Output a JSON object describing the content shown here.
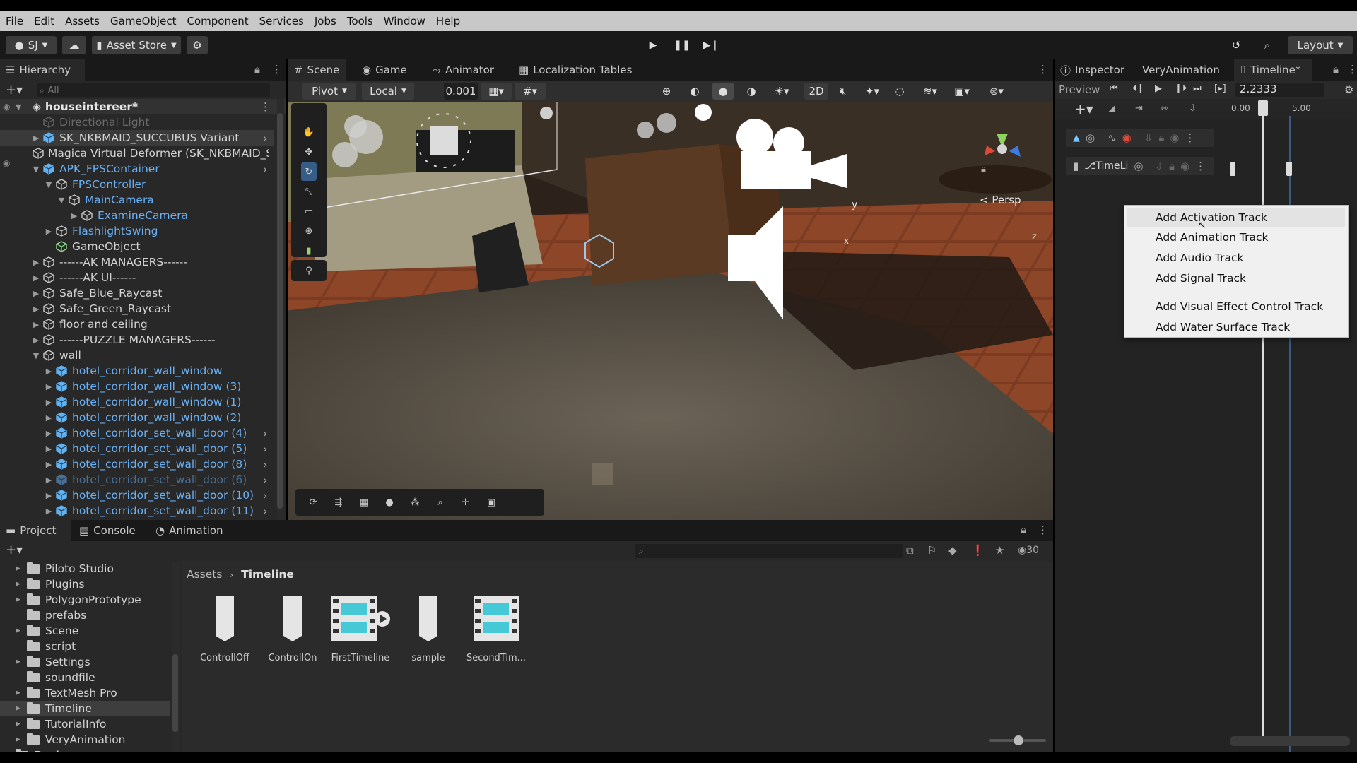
{
  "menu": [
    "File",
    "Edit",
    "Assets",
    "GameObject",
    "Component",
    "Services",
    "Jobs",
    "Tools",
    "Window",
    "Help"
  ],
  "toolbar": {
    "account": "SJ",
    "asset_store": "Asset Store",
    "layout": "Layout"
  },
  "hierarchy": {
    "tab": "Hierarchy",
    "search_placeholder": "All",
    "scene_name": "houseintereer*",
    "items": [
      {
        "label": "Directional Light"
      },
      {
        "label": "SK_NKBMAID_SUCCUBUS Variant"
      },
      {
        "label": "Magica Virtual Deformer (SK_NKBMAID_S"
      },
      {
        "label": "APK_FPSContainer"
      },
      {
        "label": "FPSController"
      },
      {
        "label": "MainCamera"
      },
      {
        "label": "ExamineCamera"
      },
      {
        "label": "FlashlightSwing"
      },
      {
        "label": "GameObject"
      },
      {
        "label": "------AK MANAGERS------"
      },
      {
        "label": "------AK UI------"
      },
      {
        "label": "Safe_Blue_Raycast"
      },
      {
        "label": "Safe_Green_Raycast"
      },
      {
        "label": "floor and ceiling"
      },
      {
        "label": "------PUZZLE MANAGERS------"
      },
      {
        "label": "wall"
      },
      {
        "label": "hotel_corridor_wall_window"
      },
      {
        "label": "hotel_corridor_wall_window (3)"
      },
      {
        "label": "hotel_corridor_wall_window (1)"
      },
      {
        "label": "hotel_corridor_wall_window (2)"
      },
      {
        "label": "hotel_corridor_set_wall_door (4)"
      },
      {
        "label": "hotel_corridor_set_wall_door (5)"
      },
      {
        "label": "hotel_corridor_set_wall_door (8)"
      },
      {
        "label": "hotel_corridor_set_wall_door (6)"
      },
      {
        "label": "hotel_corridor_set_wall_door (10)"
      },
      {
        "label": "hotel_corridor_set_wall_door (11)"
      }
    ]
  },
  "scene": {
    "tabs": [
      "Scene",
      "Game",
      "Animator",
      "Localization Tables"
    ],
    "pivot": "Pivot",
    "local": "Local",
    "snap": "0.001",
    "mode_2d": "2D",
    "persp": "< Persp",
    "gizmo_y": "y",
    "gizmo_x": "x",
    "gizmo_z": "z"
  },
  "right_tabs": [
    "Inspector",
    "VeryAnimation",
    "Timeline*"
  ],
  "timeline": {
    "preview": "Preview",
    "time": "2.2333",
    "ruler_start": "0.00",
    "ruler_mark": "5.00",
    "track_label": "TimeLi"
  },
  "context_menu": [
    "Add Activation Track",
    "Add Animation Track",
    "Add Audio Track",
    "Add Signal Track",
    "Add Visual Effect Control Track",
    "Add Water Surface Track"
  ],
  "bottom": {
    "tabs": [
      "Project",
      "Console",
      "Animation"
    ],
    "hidden_count": "30",
    "breadcrumb_root": "Assets",
    "breadcrumb_current": "Timeline",
    "folders": [
      "Piloto Studio",
      "Plugins",
      "PolygonPrototype",
      "prefabs",
      "Scene",
      "script",
      "Settings",
      "soundfile",
      "TextMesh Pro",
      "Timeline",
      "TutorialInfo",
      "VeryAnimation"
    ],
    "packages": "Packages",
    "assets": [
      "ControllOff",
      "ControllOn",
      "FirstTimeline",
      "sample",
      "SecondTim..."
    ]
  }
}
